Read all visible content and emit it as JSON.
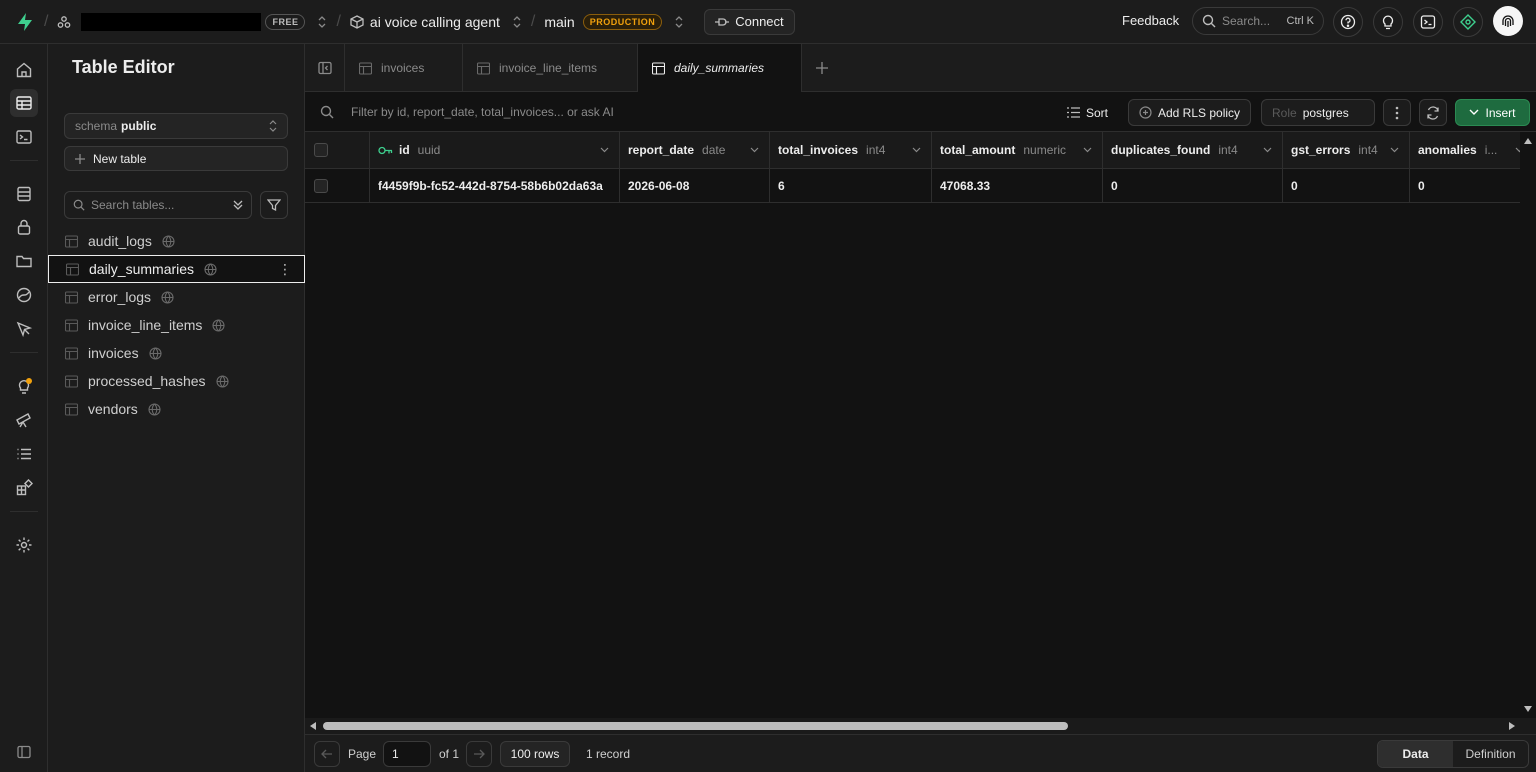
{
  "topbar": {
    "org_plan": "FREE",
    "project_name": "ai voice calling agent",
    "branch_name": "main",
    "branch_env": "PRODUCTION",
    "connect_label": "Connect",
    "feedback_label": "Feedback",
    "search_placeholder": "Search...",
    "search_shortcut": "Ctrl K"
  },
  "sidebar": {
    "title": "Table Editor",
    "schema_label": "schema",
    "schema_value": "public",
    "new_table_label": "New table",
    "search_placeholder": "Search tables...",
    "tables": [
      {
        "name": "audit_logs"
      },
      {
        "name": "daily_summaries",
        "active": true
      },
      {
        "name": "error_logs"
      },
      {
        "name": "invoice_line_items"
      },
      {
        "name": "invoices"
      },
      {
        "name": "processed_hashes"
      },
      {
        "name": "vendors"
      }
    ]
  },
  "tabs": [
    {
      "label": "invoices"
    },
    {
      "label": "invoice_line_items"
    },
    {
      "label": "daily_summaries",
      "active": true
    }
  ],
  "toolbar": {
    "filter_placeholder": "Filter by id, report_date, total_invoices... or ask AI",
    "sort_label": "Sort",
    "rls_label": "Add RLS policy",
    "role_label": "Role",
    "role_value": "postgres",
    "insert_label": "Insert"
  },
  "grid": {
    "columns": [
      {
        "name": "id",
        "type": "uuid"
      },
      {
        "name": "report_date",
        "type": "date"
      },
      {
        "name": "total_invoices",
        "type": "int4"
      },
      {
        "name": "total_amount",
        "type": "numeric"
      },
      {
        "name": "duplicates_found",
        "type": "int4"
      },
      {
        "name": "gst_errors",
        "type": "int4"
      },
      {
        "name": "anomalies",
        "type": "i..."
      }
    ],
    "rows": [
      [
        "f4459f9b-fc52-442d-8754-58b6b02da63a",
        "2026-06-08",
        "6",
        "47068.33",
        "0",
        "0",
        "0"
      ]
    ]
  },
  "footer": {
    "page_label": "Page",
    "page_value": "1",
    "of_label": "of 1",
    "rows_label": "100 rows",
    "record_count": "1 record",
    "view_data": "Data",
    "view_definition": "Definition"
  },
  "colors": {
    "background": "#121212",
    "panel": "#1c1c1c",
    "brand_green": "#3ecf8e",
    "insert_green": "#1e6b3f",
    "production_amber": "#f1a10d"
  }
}
